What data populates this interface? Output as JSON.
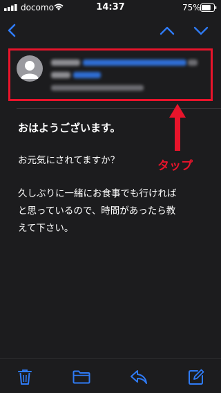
{
  "status_bar": {
    "carrier": "docomo",
    "time": "14:37",
    "battery_percent": "75%",
    "battery_level": 0.75
  },
  "nav": {
    "back_icon": "chevron-left-icon",
    "prev_icon": "chevron-up-icon",
    "next_icon": "chevron-down-icon"
  },
  "message": {
    "subject": "おはようございます。",
    "paragraph1": "お元気にされてますか？",
    "paragraph2_line1": "久しぶりに一緒にお食事でも行ければ",
    "paragraph2_line2": "と思っているので、時間があったら教",
    "paragraph2_line3": "えて下さい。"
  },
  "annotation": {
    "label": "タップ"
  },
  "toolbar": {
    "icons": [
      "trash-icon",
      "folder-icon",
      "reply-icon",
      "compose-icon"
    ]
  },
  "colors": {
    "accent": "#2f7bf6",
    "annotation": "#e8142b",
    "background": "#1c1c1e"
  }
}
